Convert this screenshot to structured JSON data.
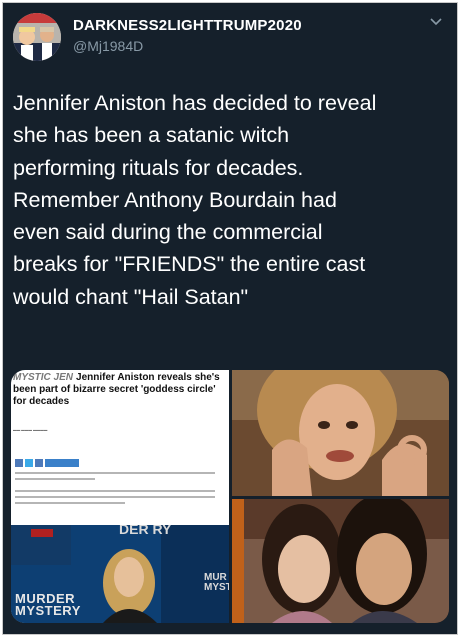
{
  "tweet": {
    "display_name": "DARKNESS2LIGHTTRUMP2020",
    "handle": "@Mj1984D",
    "text_lines": [
      "Jennifer Aniston has decided to reveal",
      "she has been a satanic witch",
      "performing rituals for decades.",
      "Remember Anthony Bourdain had",
      "even said during the commercial",
      "breaks for \"FRIENDS\" the entire cast",
      "would chant \"Hail Satan\""
    ]
  },
  "article": {
    "brand": "MYSTIC JEN",
    "headline": "Jennifer Aniston reveals she's been part of bizarre secret 'goddess circle' for decades",
    "photo_text_left": "MURDER MYSTERY",
    "photo_text_top": "DER RY",
    "photo_text_right": "MUR MYST"
  },
  "colors": {
    "background": "#15202b",
    "text": "#ffffff",
    "muted": "#8899a6"
  },
  "icons": {
    "avatar": "profile-photo",
    "menu": "chevron-down-icon"
  }
}
